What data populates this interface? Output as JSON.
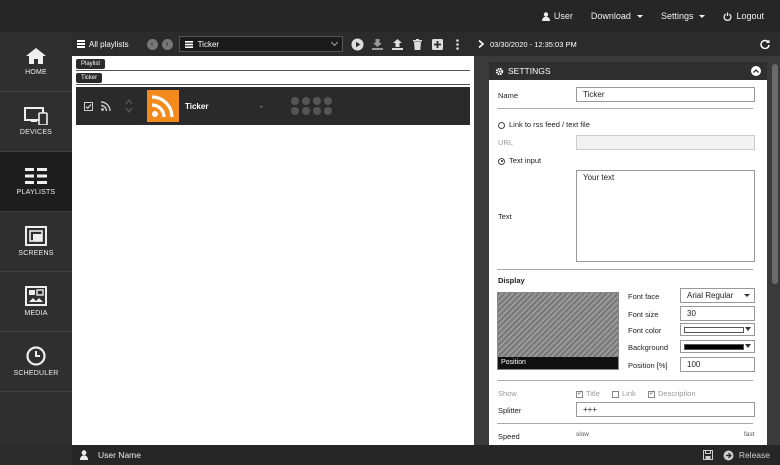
{
  "topnav": {
    "user": "User",
    "download": "Download",
    "settings": "Settings",
    "logout": "Logout"
  },
  "sidebar": {
    "items": [
      {
        "label": "HOME",
        "icon": "home-icon"
      },
      {
        "label": "DEVICES",
        "icon": "devices-icon"
      },
      {
        "label": "PLAYLISTS",
        "icon": "playlists-icon"
      },
      {
        "label": "SCREENS",
        "icon": "screens-icon"
      },
      {
        "label": "MEDIA",
        "icon": "media-icon"
      },
      {
        "label": "SCHEDULER",
        "icon": "scheduler-icon"
      }
    ]
  },
  "playlist": {
    "all_label": "All playlists",
    "selected": "Ticker",
    "tag_playlist": "Playlist",
    "tag_ticker": "Ticker",
    "row": {
      "title": "Ticker",
      "duration": "-"
    }
  },
  "details": {
    "timestamp": "03/30/2020 - 12:35:03 PM",
    "settings_title": "SETTINGS",
    "name_label": "Name",
    "name_value": "Ticker",
    "link_label": "Link to rss feed / text file",
    "url_label": "URL",
    "url_value": "",
    "text_input_label": "Text input",
    "text_label": "Text",
    "text_value": "Your text",
    "display_label": "Display",
    "preview_label": "Position",
    "font_face_label": "Font face",
    "font_face_value": "Arial Regular",
    "font_size_label": "Font size",
    "font_size_value": "30",
    "font_color_label": "Font color",
    "font_color_hex": "#ffffff",
    "background_label": "Background",
    "background_hex": "#000000",
    "position_label": "Position [%]",
    "position_value": "100",
    "show_label": "Show",
    "show_title": "Title",
    "show_link": "Link",
    "show_description": "Description",
    "splitter_label": "Splitter",
    "splitter_value": "+++",
    "speed_label": "Speed",
    "speed_slow": "slow",
    "speed_fast": "fast"
  },
  "status": {
    "user_name": "User Name",
    "release": "Release"
  }
}
